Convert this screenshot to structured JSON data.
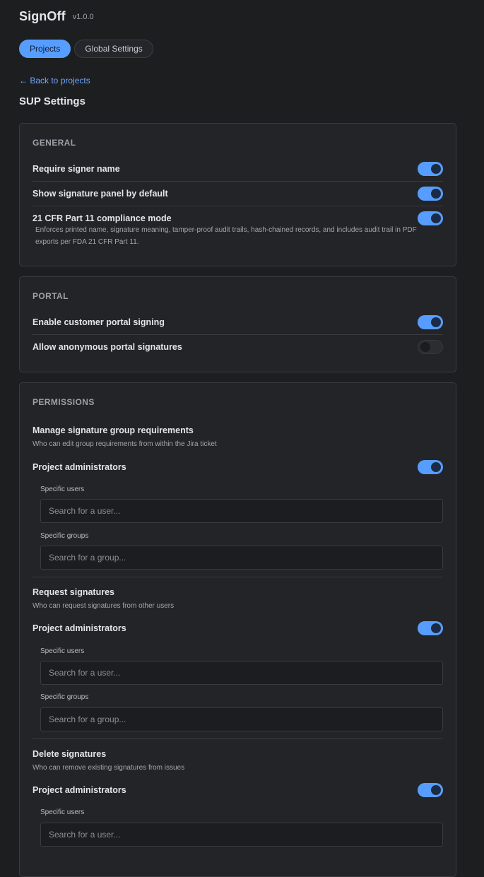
{
  "app": {
    "title": "SignOff",
    "version": "v1.0.0"
  },
  "tabs": [
    {
      "label": "Projects",
      "active": true
    },
    {
      "label": "Global Settings",
      "active": false
    }
  ],
  "back_link": "← Back to projects",
  "page_title": "SUP Settings",
  "general": {
    "title": "GENERAL",
    "items": [
      {
        "label": "Require signer name",
        "on": true
      },
      {
        "label": "Show signature panel by default",
        "on": true
      },
      {
        "label": "21 CFR Part 11 compliance mode",
        "on": true,
        "description": "Enforces printed name, signature meaning, tamper-proof audit trails, hash-chained records, and includes audit trail in PDF exports per FDA 21 CFR Part 11."
      }
    ]
  },
  "portal": {
    "title": "PORTAL",
    "items": [
      {
        "label": "Enable customer portal signing",
        "on": true
      },
      {
        "label": "Allow anonymous portal signatures",
        "on": false
      }
    ]
  },
  "permissions": {
    "title": "PERMISSIONS",
    "groups": [
      {
        "title": "Manage signature group requirements",
        "description": "Who can edit group requirements from within the Jira ticket",
        "admin_label": "Project administrators",
        "admin_on": true,
        "users_label": "Specific users",
        "users_placeholder": "Search for a user...",
        "groups_label": "Specific groups",
        "groups_placeholder": "Search for a group..."
      },
      {
        "title": "Request signatures",
        "description": "Who can request signatures from other users",
        "admin_label": "Project administrators",
        "admin_on": true,
        "users_label": "Specific users",
        "users_placeholder": "Search for a user...",
        "groups_label": "Specific groups",
        "groups_placeholder": "Search for a group..."
      },
      {
        "title": "Delete signatures",
        "description": "Who can remove existing signatures from issues",
        "admin_label": "Project administrators",
        "admin_on": true,
        "users_label": "Specific users",
        "users_placeholder": "Search for a user..."
      }
    ]
  },
  "colors": {
    "background": "#1d1e20",
    "card": "#232428",
    "accent": "#579dff",
    "link": "#6ea8ff"
  }
}
